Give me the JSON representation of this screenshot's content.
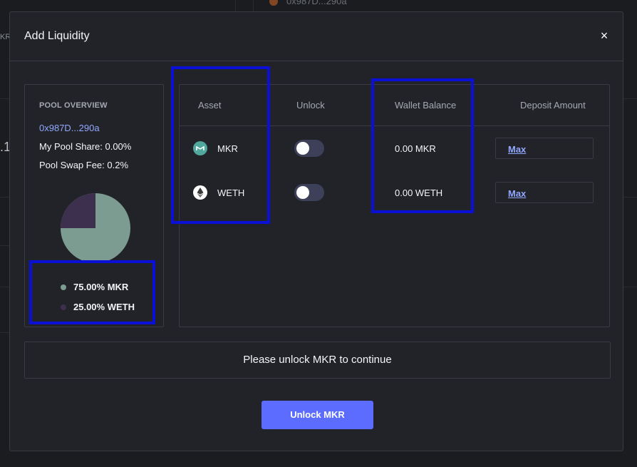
{
  "background": {
    "top_address": "0x987D...290a",
    "left_fragment": "KR",
    "left_number": ".1"
  },
  "modal": {
    "title": "Add Liquidity",
    "close_symbol": "×"
  },
  "pool_overview": {
    "heading": "POOL OVERVIEW",
    "address": "0x987D...290a",
    "my_pool_share": "My Pool Share: 0.00%",
    "pool_swap_fee": "Pool Swap Fee: 0.2%",
    "composition": [
      {
        "label": "75.00% MKR",
        "percent": 75,
        "color": "#7d9c91"
      },
      {
        "label": "25.00% WETH",
        "percent": 25,
        "color": "#3d2f4e"
      }
    ]
  },
  "table": {
    "headers": {
      "asset": "Asset",
      "unlock": "Unlock",
      "wallet_balance": "Wallet Balance",
      "deposit_amount": "Deposit Amount"
    },
    "rows": [
      {
        "asset": "MKR",
        "icon": "mkr-icon",
        "unlocked": false,
        "wallet_balance": "0.00 MKR",
        "max_label": "Max"
      },
      {
        "asset": "WETH",
        "icon": "weth-icon",
        "unlocked": false,
        "wallet_balance": "0.00 WETH",
        "max_label": "Max"
      }
    ]
  },
  "status_message": "Please unlock MKR to continue",
  "unlock_button": "Unlock MKR",
  "colors": {
    "accent": "#5b6cff",
    "link": "#90a8ff",
    "annotation": "#0a10d8"
  }
}
